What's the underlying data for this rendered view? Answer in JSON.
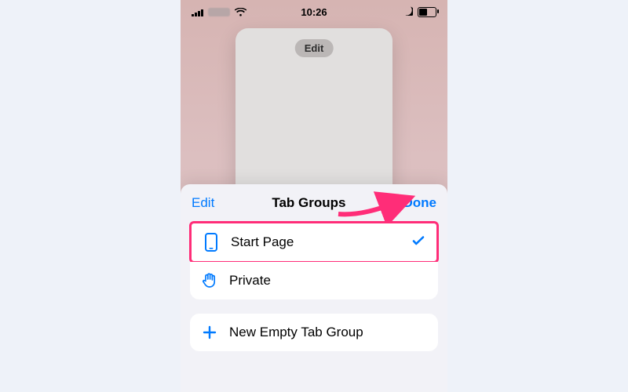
{
  "status": {
    "time": "10:26"
  },
  "bgCard": {
    "editLabel": "Edit"
  },
  "sheet": {
    "header": {
      "leading": "Edit",
      "title": "Tab Groups",
      "trailing": "Done"
    },
    "items": [
      {
        "label": "Start Page",
        "selected": true
      },
      {
        "label": "Private",
        "selected": false
      }
    ],
    "newGroup": {
      "label": "New Empty Tab Group"
    }
  }
}
